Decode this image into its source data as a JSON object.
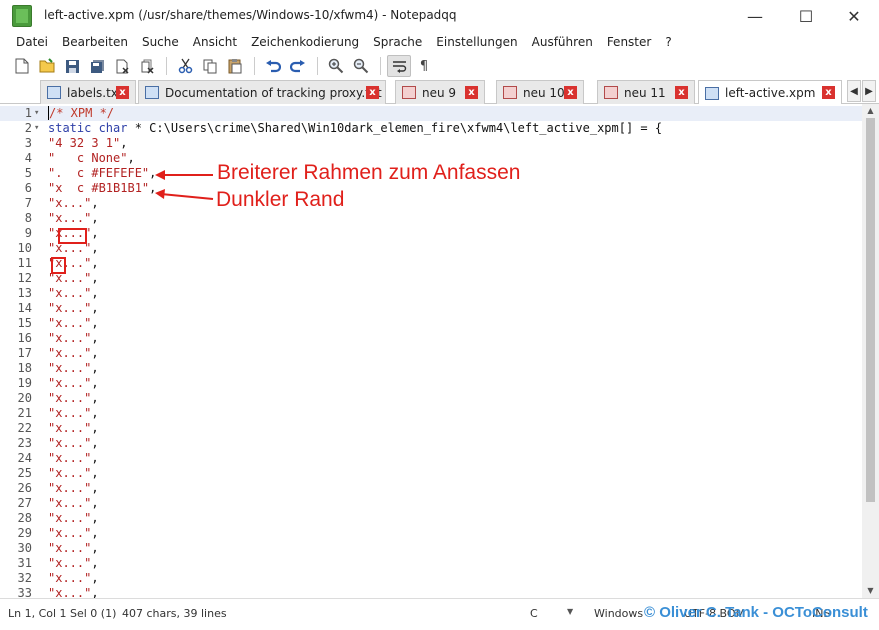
{
  "window": {
    "title": "left-active.xpm (/usr/share/themes/Windows-10/xfwm4) - Notepadqq",
    "minimize_glyph": "—",
    "maximize_glyph": "☐",
    "close_glyph": "✕"
  },
  "menu": [
    "Datei",
    "Bearbeiten",
    "Suche",
    "Ansicht",
    "Zeichenkodierung",
    "Sprache",
    "Einstellungen",
    "Ausführen",
    "Fenster",
    "?"
  ],
  "toolbar": {
    "icons": [
      "new-file-icon",
      "open-file-icon",
      "save-icon",
      "save-all-icon",
      "close-file-icon",
      "close-all-icon",
      "cut-icon",
      "copy-icon",
      "paste-icon",
      "undo-icon",
      "redo-icon",
      "zoom-in-icon",
      "zoom-out-icon",
      "word-wrap-icon",
      "show-symbols-icon"
    ],
    "pilcrow": "¶"
  },
  "tabs": [
    {
      "label": "labels.txt",
      "modified": false,
      "active": false
    },
    {
      "label": "Documentation of tracking proxy.txt",
      "modified": false,
      "active": false
    },
    {
      "label": "neu 9",
      "modified": true,
      "active": false
    },
    {
      "label": "neu 10",
      "modified": true,
      "active": false
    },
    {
      "label": "neu 11",
      "modified": true,
      "active": false
    },
    {
      "label": "left-active.xpm",
      "modified": false,
      "active": true
    }
  ],
  "tab_close_glyph": "x",
  "editor": {
    "lines": [
      {
        "n": "1",
        "fold": "▾",
        "segments": [
          {
            "t": "/* XPM */",
            "c": "comment"
          }
        ]
      },
      {
        "n": "2",
        "fold": "▾",
        "segments": [
          {
            "t": "static char",
            "c": "kw"
          },
          {
            "t": " * C:\\Users\\crime\\Shared\\Win10dark_elemen_fire\\xfwm4\\left_active_xpm[] = {",
            "c": "plain"
          }
        ]
      },
      {
        "n": "3",
        "fold": "",
        "segments": [
          {
            "t": "\"4 32 3 1\"",
            "c": "str"
          },
          {
            "t": ",",
            "c": "plain"
          }
        ]
      },
      {
        "n": "4",
        "fold": "",
        "segments": [
          {
            "t": "\"   c None\"",
            "c": "str"
          },
          {
            "t": ",",
            "c": "plain"
          }
        ]
      },
      {
        "n": "5",
        "fold": "",
        "segments": [
          {
            "t": "\".  c #FEFEFE\"",
            "c": "str"
          },
          {
            "t": ",",
            "c": "plain"
          }
        ]
      },
      {
        "n": "6",
        "fold": "",
        "segments": [
          {
            "t": "\"x  c #B1B1B1\"",
            "c": "str"
          },
          {
            "t": ",",
            "c": "plain"
          }
        ]
      },
      {
        "n": "7",
        "fold": "",
        "segments": [
          {
            "t": "\"x...\"",
            "c": "str"
          },
          {
            "t": ",",
            "c": "plain"
          }
        ]
      },
      {
        "n": "8",
        "fold": "",
        "segments": [
          {
            "t": "\"x...\"",
            "c": "str"
          },
          {
            "t": ",",
            "c": "plain"
          }
        ]
      },
      {
        "n": "9",
        "fold": "",
        "segments": [
          {
            "t": "\"x...\"",
            "c": "str"
          },
          {
            "t": ",",
            "c": "plain"
          }
        ]
      },
      {
        "n": "10",
        "fold": "",
        "segments": [
          {
            "t": "\"x...\"",
            "c": "str"
          },
          {
            "t": ",",
            "c": "plain"
          }
        ]
      },
      {
        "n": "11",
        "fold": "",
        "segments": [
          {
            "t": "\"x...\"",
            "c": "str"
          },
          {
            "t": ",",
            "c": "plain"
          }
        ]
      },
      {
        "n": "12",
        "fold": "",
        "segments": [
          {
            "t": "\"x...\"",
            "c": "str"
          },
          {
            "t": ",",
            "c": "plain"
          }
        ]
      },
      {
        "n": "13",
        "fold": "",
        "segments": [
          {
            "t": "\"x...\"",
            "c": "str"
          },
          {
            "t": ",",
            "c": "plain"
          }
        ]
      },
      {
        "n": "14",
        "fold": "",
        "segments": [
          {
            "t": "\"x...\"",
            "c": "str"
          },
          {
            "t": ",",
            "c": "plain"
          }
        ]
      },
      {
        "n": "15",
        "fold": "",
        "segments": [
          {
            "t": "\"x...\"",
            "c": "str"
          },
          {
            "t": ",",
            "c": "plain"
          }
        ]
      },
      {
        "n": "16",
        "fold": "",
        "segments": [
          {
            "t": "\"x...\"",
            "c": "str"
          },
          {
            "t": ",",
            "c": "plain"
          }
        ]
      },
      {
        "n": "17",
        "fold": "",
        "segments": [
          {
            "t": "\"x...\"",
            "c": "str"
          },
          {
            "t": ",",
            "c": "plain"
          }
        ]
      },
      {
        "n": "18",
        "fold": "",
        "segments": [
          {
            "t": "\"x...\"",
            "c": "str"
          },
          {
            "t": ",",
            "c": "plain"
          }
        ]
      },
      {
        "n": "19",
        "fold": "",
        "segments": [
          {
            "t": "\"x...\"",
            "c": "str"
          },
          {
            "t": ",",
            "c": "plain"
          }
        ]
      },
      {
        "n": "20",
        "fold": "",
        "segments": [
          {
            "t": "\"x...\"",
            "c": "str"
          },
          {
            "t": ",",
            "c": "plain"
          }
        ]
      },
      {
        "n": "21",
        "fold": "",
        "segments": [
          {
            "t": "\"x...\"",
            "c": "str"
          },
          {
            "t": ",",
            "c": "plain"
          }
        ]
      },
      {
        "n": "22",
        "fold": "",
        "segments": [
          {
            "t": "\"x...\"",
            "c": "str"
          },
          {
            "t": ",",
            "c": "plain"
          }
        ]
      },
      {
        "n": "23",
        "fold": "",
        "segments": [
          {
            "t": "\"x...\"",
            "c": "str"
          },
          {
            "t": ",",
            "c": "plain"
          }
        ]
      },
      {
        "n": "24",
        "fold": "",
        "segments": [
          {
            "t": "\"x...\"",
            "c": "str"
          },
          {
            "t": ",",
            "c": "plain"
          }
        ]
      },
      {
        "n": "25",
        "fold": "",
        "segments": [
          {
            "t": "\"x...\"",
            "c": "str"
          },
          {
            "t": ",",
            "c": "plain"
          }
        ]
      },
      {
        "n": "26",
        "fold": "",
        "segments": [
          {
            "t": "\"x...\"",
            "c": "str"
          },
          {
            "t": ",",
            "c": "plain"
          }
        ]
      },
      {
        "n": "27",
        "fold": "",
        "segments": [
          {
            "t": "\"x...\"",
            "c": "str"
          },
          {
            "t": ",",
            "c": "plain"
          }
        ]
      },
      {
        "n": "28",
        "fold": "",
        "segments": [
          {
            "t": "\"x...\"",
            "c": "str"
          },
          {
            "t": ",",
            "c": "plain"
          }
        ]
      },
      {
        "n": "29",
        "fold": "",
        "segments": [
          {
            "t": "\"x...\"",
            "c": "str"
          },
          {
            "t": ",",
            "c": "plain"
          }
        ]
      },
      {
        "n": "30",
        "fold": "",
        "segments": [
          {
            "t": "\"x...\"",
            "c": "str"
          },
          {
            "t": ",",
            "c": "plain"
          }
        ]
      },
      {
        "n": "31",
        "fold": "",
        "segments": [
          {
            "t": "\"x...\"",
            "c": "str"
          },
          {
            "t": ",",
            "c": "plain"
          }
        ]
      },
      {
        "n": "32",
        "fold": "",
        "segments": [
          {
            "t": "\"x...\"",
            "c": "str"
          },
          {
            "t": ",",
            "c": "plain"
          }
        ]
      },
      {
        "n": "33",
        "fold": "",
        "segments": [
          {
            "t": "\"x...\"",
            "c": "str"
          },
          {
            "t": ",",
            "c": "plain"
          }
        ]
      }
    ]
  },
  "annotations": {
    "wide_border": "Breiterer Rahmen zum Anfassen",
    "dark_edge": "Dunkler Rand"
  },
  "statusbar": {
    "position": "Ln 1, Col 1",
    "selection": "Sel 0 (1)",
    "stats": "407 chars, 39 lines",
    "language": "C",
    "eol": "Windows",
    "encoding": "UTF-8 BOM",
    "mode": "INS"
  },
  "watermark": "© Oliver C. Tank - OCToConsult",
  "colors": {
    "annotation": "#e0201b",
    "tab_close": "#d9322f",
    "watermark": "#3a8fd6",
    "current_line": "#e9eef8"
  }
}
